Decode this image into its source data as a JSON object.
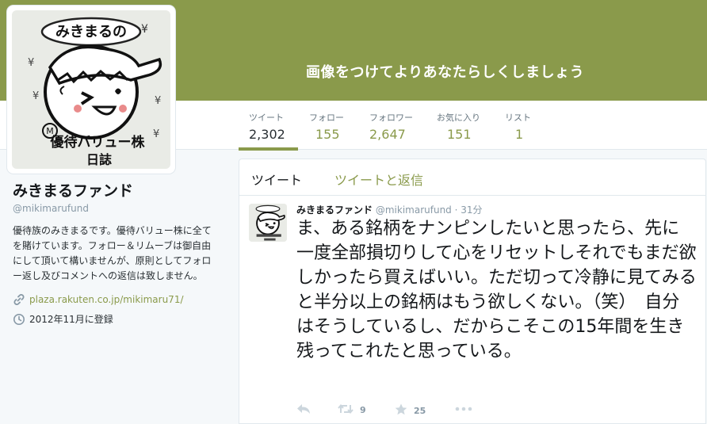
{
  "header": {
    "prompt": "画像をつけてよりあなたらしくしましょう"
  },
  "stats": [
    {
      "label": "ツイート",
      "value": "2,302"
    },
    {
      "label": "フォロー",
      "value": "155"
    },
    {
      "label": "フォロワー",
      "value": "2,647"
    },
    {
      "label": "お気に入り",
      "value": "151"
    },
    {
      "label": "リスト",
      "value": "1"
    }
  ],
  "avatar": {
    "title": "みきまるの",
    "line1": "優待バリュー株",
    "line2": "日誌",
    "yen": "¥"
  },
  "profile": {
    "name": "みきまるファンド",
    "handle": "@mikimarufund",
    "bio": "優待族のみきまるです。優待バリュー株に全てを賭けています。フォロー＆リムーブは御自由にして頂いて構いませんが、原則としてフォロー返し及びコメントへの返信は致しません。",
    "url": "plaza.rakuten.co.jp/mikimaru71/",
    "joined": "2012年11月に登録"
  },
  "tabs": {
    "tweets": "ツイート",
    "replies": "ツイートと返信"
  },
  "tweet": {
    "name": "みきまるファンド",
    "handle": "@mikimarufund",
    "separator": "·",
    "time": "31分",
    "text": "ま、ある銘柄をナンピンしたいと思ったら、先に一度全部損切りして心をリセットしそれでもまだ欲しかったら買えばいい。ただ切って冷静に見てみると半分以上の銘柄はもう欲しくない。（笑）　自分はそうしているし、だからこそこの15年間を生き残ってこれたと思っている。",
    "retweets": "9",
    "favorites": "25"
  },
  "colors": {
    "accent": "#8a9a4b",
    "text": "#292f33",
    "muted": "#8899a6"
  },
  "icons": [
    "link-icon",
    "clock-icon",
    "reply-icon",
    "retweet-icon",
    "star-icon",
    "more-icon"
  ]
}
